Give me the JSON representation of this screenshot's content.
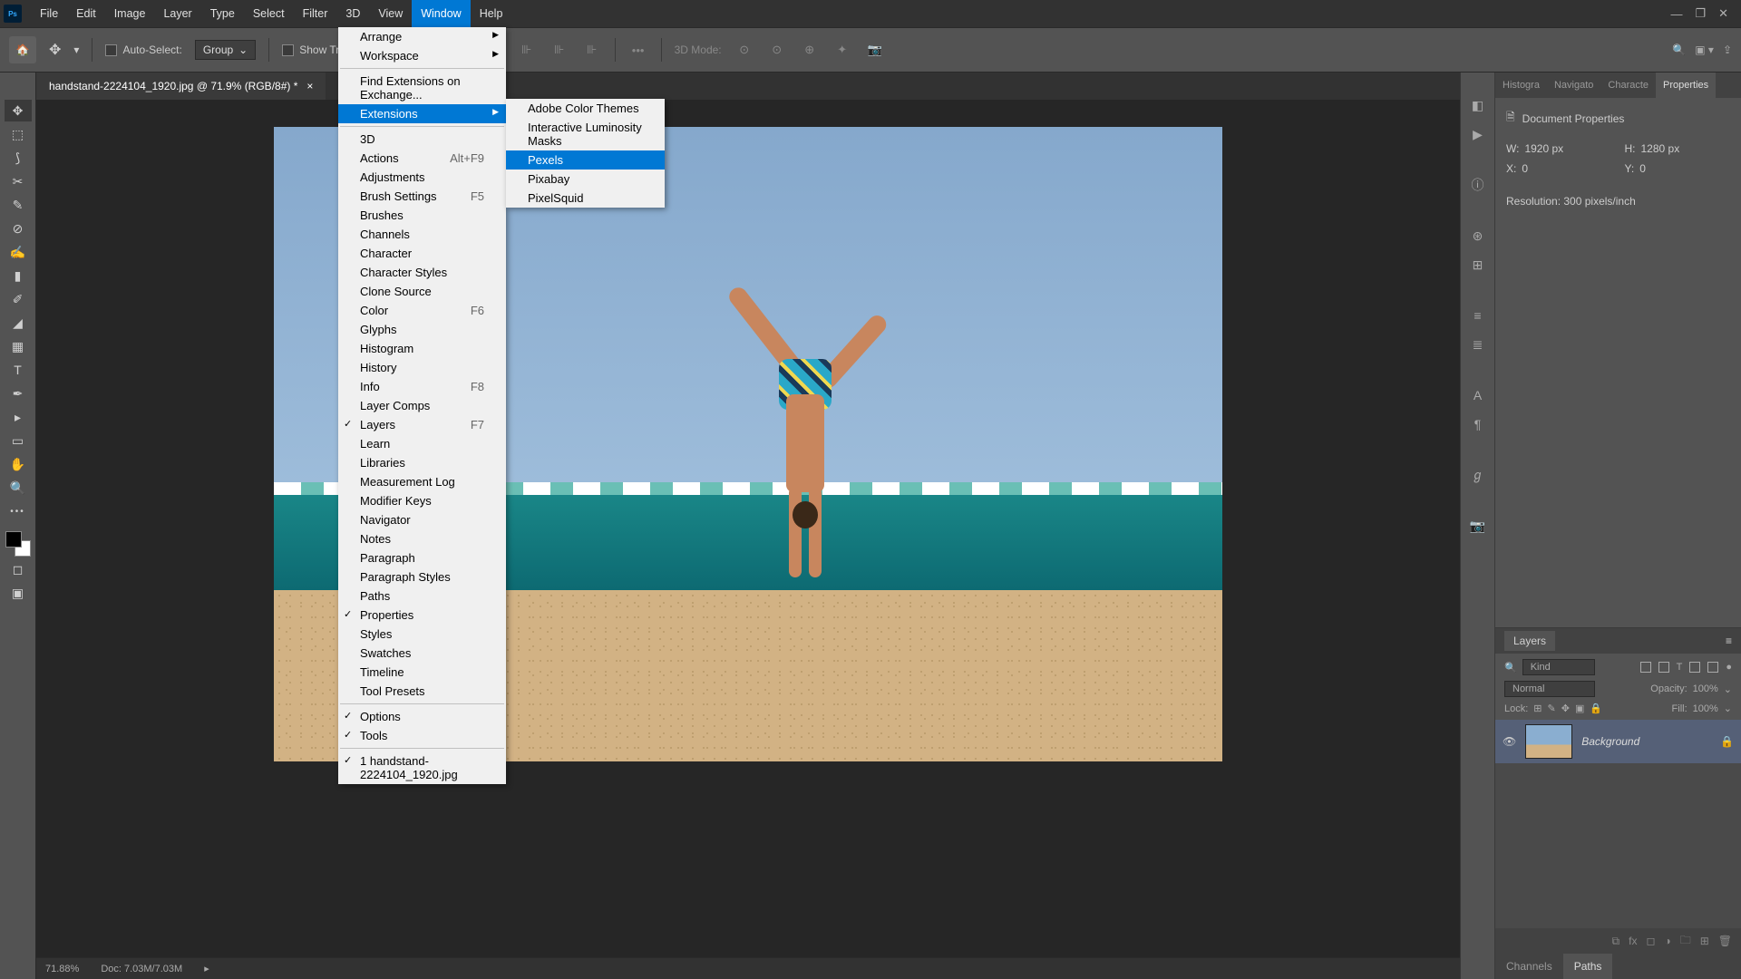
{
  "menubar": [
    "File",
    "Edit",
    "Image",
    "Layer",
    "Type",
    "Select",
    "Filter",
    "3D",
    "View",
    "Window",
    "Help"
  ],
  "active_menu": "Window",
  "options": {
    "auto_select": "Auto-Select:",
    "group": "Group",
    "show_transform": "Show Transform",
    "mode_3d": "3D Mode:"
  },
  "tab": {
    "title": "handstand-2224104_1920.jpg @ 71.9% (RGB/8#) *"
  },
  "status": {
    "zoom": "71.88%",
    "doc": "Doc: 7.03M/7.03M"
  },
  "window_menu": {
    "top": [
      {
        "l": "Arrange",
        "sub": true
      },
      {
        "l": "Workspace",
        "sub": true
      }
    ],
    "find": "Find Extensions on Exchange...",
    "ext": "Extensions",
    "items": [
      {
        "l": "3D"
      },
      {
        "l": "Actions",
        "s": "Alt+F9"
      },
      {
        "l": "Adjustments"
      },
      {
        "l": "Brush Settings",
        "s": "F5"
      },
      {
        "l": "Brushes"
      },
      {
        "l": "Channels"
      },
      {
        "l": "Character"
      },
      {
        "l": "Character Styles"
      },
      {
        "l": "Clone Source"
      },
      {
        "l": "Color",
        "s": "F6"
      },
      {
        "l": "Glyphs"
      },
      {
        "l": "Histogram"
      },
      {
        "l": "History"
      },
      {
        "l": "Info",
        "s": "F8"
      },
      {
        "l": "Layer Comps"
      },
      {
        "l": "Layers",
        "s": "F7",
        "c": true
      },
      {
        "l": "Learn"
      },
      {
        "l": "Libraries"
      },
      {
        "l": "Measurement Log"
      },
      {
        "l": "Modifier Keys"
      },
      {
        "l": "Navigator"
      },
      {
        "l": "Notes"
      },
      {
        "l": "Paragraph"
      },
      {
        "l": "Paragraph Styles"
      },
      {
        "l": "Paths"
      },
      {
        "l": "Properties",
        "c": true
      },
      {
        "l": "Styles"
      },
      {
        "l": "Swatches"
      },
      {
        "l": "Timeline"
      },
      {
        "l": "Tool Presets"
      }
    ],
    "bot": [
      {
        "l": "Options",
        "c": true
      },
      {
        "l": "Tools",
        "c": true
      }
    ],
    "doc": "1 handstand-2224104_1920.jpg"
  },
  "ext_menu": [
    "Adobe Color Themes",
    "Interactive Luminosity Masks",
    "Pexels",
    "Pixabay",
    "PixelSquid"
  ],
  "ext_active": "Pexels",
  "panels": {
    "tabs": [
      "Histogra",
      "Navigato",
      "Characte",
      "Properties"
    ],
    "props": {
      "title": "Document Properties",
      "w_l": "W:",
      "w": "1920 px",
      "h_l": "H:",
      "h": "1280 px",
      "x_l": "X:",
      "x": "0",
      "y_l": "Y:",
      "y": "0",
      "res": "Resolution: 300 pixels/inch"
    },
    "layers": {
      "title": "Layers",
      "kind": "Kind",
      "blend": "Normal",
      "opacity_l": "Opacity:",
      "opacity": "100%",
      "lock_l": "Lock:",
      "fill_l": "Fill:",
      "fill": "100%",
      "layer_name": "Background"
    },
    "bottom": [
      "Channels",
      "Paths"
    ]
  }
}
